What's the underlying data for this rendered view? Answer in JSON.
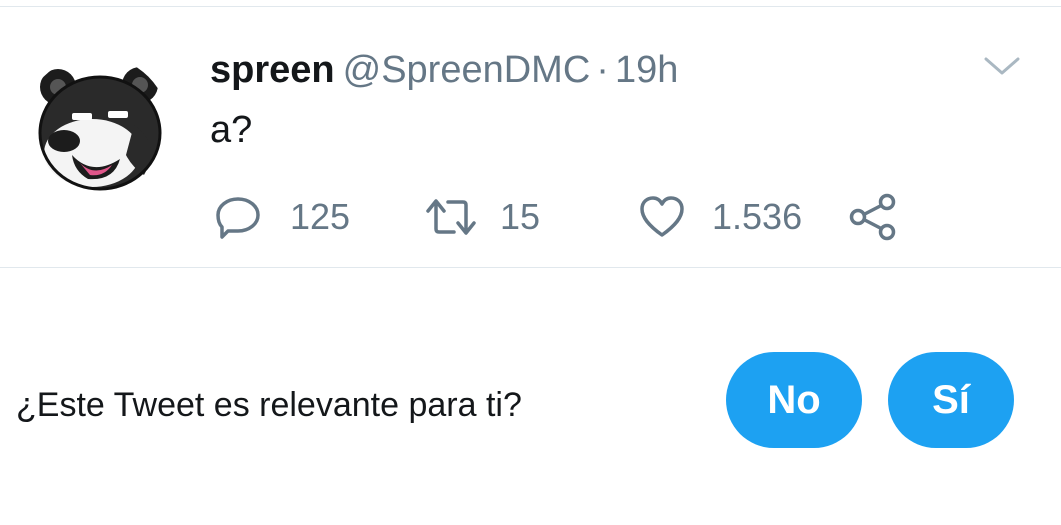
{
  "tweet": {
    "display_name": "spreen",
    "handle": "@SpreenDMC",
    "separator": "·",
    "time": "19h",
    "text": "a?",
    "avatar_icon": "panda-bear-avatar",
    "menu_icon": "chevron-down-icon",
    "actions": {
      "replies": {
        "icon": "reply-icon",
        "count": "125"
      },
      "retweets": {
        "icon": "retweet-icon",
        "count": "15"
      },
      "likes": {
        "icon": "heart-icon",
        "count": "1.536"
      },
      "share": {
        "icon": "share-icon"
      }
    }
  },
  "relevance": {
    "question": "¿Este Tweet es relevante para ti?",
    "no_label": "No",
    "yes_label": "Sí"
  },
  "colors": {
    "accent": "#1da1f2",
    "secondary_text": "#657786",
    "divider": "#e1e8ed"
  }
}
